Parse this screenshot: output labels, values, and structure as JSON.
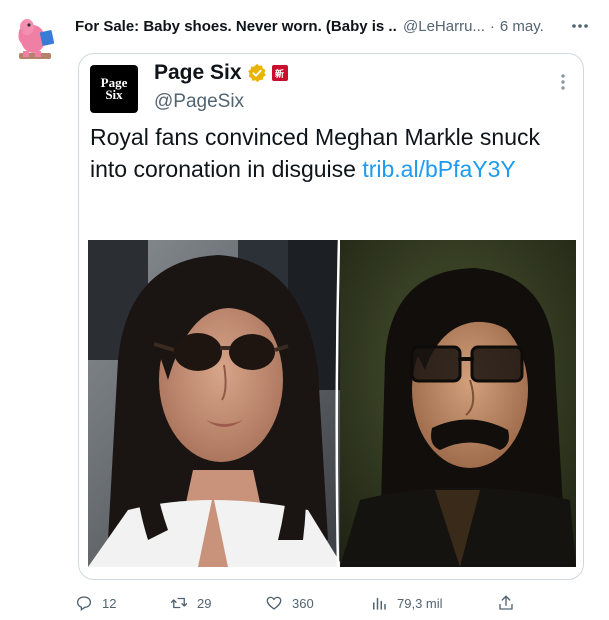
{
  "tweet": {
    "author_name": "For Sale: Baby shoes. Never worn. (Baby is ...",
    "author_handle": "@LeHarru...",
    "separator": "·",
    "time": "6 may.",
    "avatar_icon": "elephant-reading-icon"
  },
  "quote": {
    "name": "Page Six",
    "handle": "@PageSix",
    "avatar_line1": "Page",
    "avatar_line2": "Six",
    "affiliate_badge": "新",
    "text": "Royal fans convinced Meghan Markle snuck into coronation in disguise ",
    "link": "trib.al/bPfaY3Y",
    "verified_color": "#e8b400",
    "media": {
      "left_photo_icon": "woman-sunglasses-photo",
      "right_photo_icon": "man-disguise-photo"
    }
  },
  "actions": {
    "reply_count": "12",
    "retweet_count": "29",
    "like_count": "360",
    "views_count": "79,3 mil"
  },
  "colors": {
    "accent": "#1d9bf0",
    "muted": "#536471",
    "border": "#cfd9de"
  }
}
